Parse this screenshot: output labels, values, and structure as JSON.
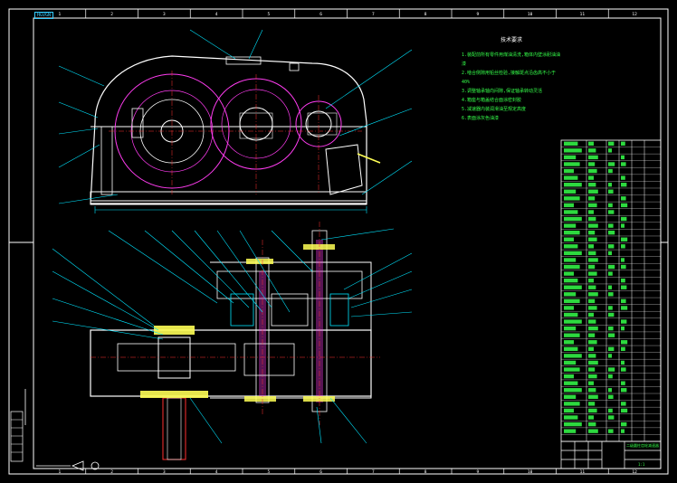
{
  "drawing": {
    "frame_stamp": "HGVGN",
    "top_ruler": [
      "1",
      "2",
      "3",
      "4",
      "5",
      "6",
      "7",
      "8",
      "9",
      "10",
      "11",
      "12"
    ],
    "bottom_ruler": [
      "1",
      "2",
      "3",
      "4",
      "5",
      "6",
      "7",
      "8",
      "9",
      "10",
      "11",
      "12"
    ],
    "notes_title": "技术要求",
    "notes": [
      "1.装配前所有零件用煤油清洗,箱体内壁涂耐油油漆",
      "2.啮合侧隙用铅丝检验,接触斑点沿齿高不小于40%",
      "3.调整轴承轴向间隙,保证轴承转动灵活",
      "4.箱座与箱盖结合面涂密封胶",
      "5.减速器内装润滑油至规定高度",
      "6.表面涂灰色油漆"
    ],
    "title_block": {
      "name": "二级圆柱齿轮减速器",
      "scale": "1:1"
    },
    "colors": {
      "frame": "#ffffff",
      "cyan": "#00e5ff",
      "green": "#35ff4a",
      "magenta": "#ff3cf0",
      "red": "#ff3030",
      "yellow": "#ffff55"
    }
  }
}
